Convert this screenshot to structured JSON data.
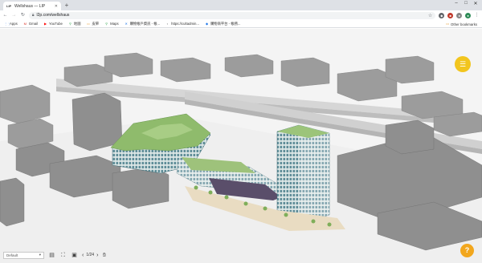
{
  "browser": {
    "tab_title": "Wellshaus — LIP",
    "tab_favicon": "LIP",
    "new_tab_icon": "plus-icon",
    "url": "l2p.com/wellshaus",
    "window_controls": [
      "–",
      "□",
      "✕"
    ]
  },
  "bookmarks": {
    "items": [
      {
        "label": "Apps",
        "icon": "apps-icon"
      },
      {
        "label": "Gmail",
        "icon": "gmail-icon"
      },
      {
        "label": "YouTube",
        "icon": "youtube-icon"
      },
      {
        "label": "地圖",
        "icon": "maps-icon"
      },
      {
        "label": "皮單",
        "icon": "folder-icon"
      },
      {
        "label": "Maps",
        "icon": "maps-icon"
      },
      {
        "label": "購物帳戶資訊 - 帳...",
        "icon": "bookmark-icon"
      },
      {
        "label": "https://cultadmin...",
        "icon": "bookmark-icon"
      },
      {
        "label": "購物商平台 - 帳務...",
        "icon": "bookmark-icon"
      }
    ],
    "other": "Other bookmarks"
  },
  "viewer": {
    "view_select": "Default",
    "page_current": "1",
    "page_total": "24",
    "page_label": "1/24",
    "accent": "#f2a71e"
  }
}
